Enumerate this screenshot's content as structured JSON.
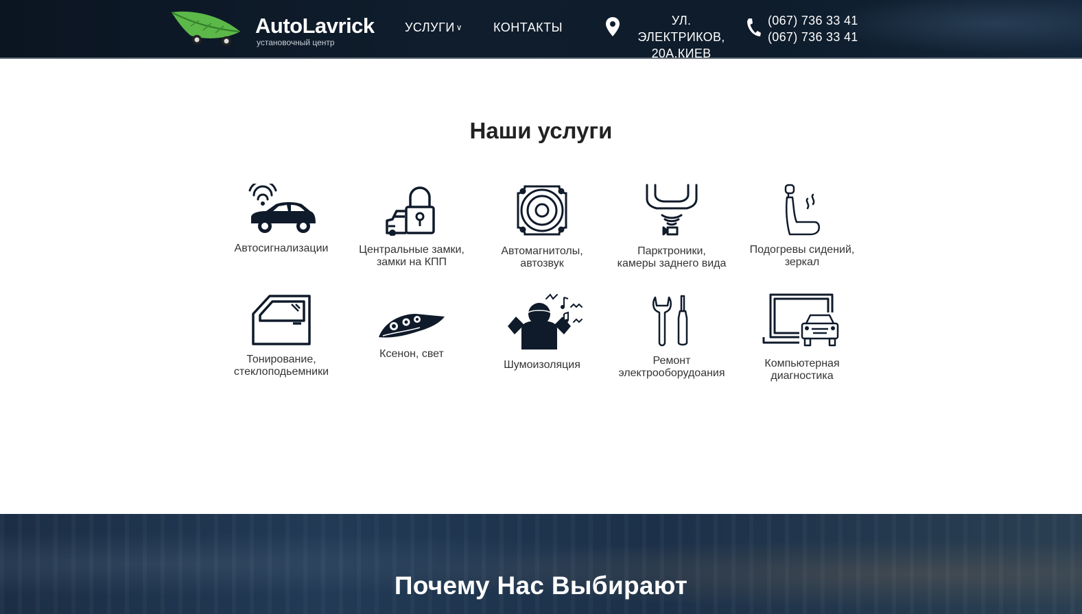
{
  "header": {
    "logo_title": "AutoLavrick",
    "logo_subtitle": "установочный центр",
    "nav": {
      "services_label": "УСЛУГИ",
      "contacts_label": "КОНТАКТЫ"
    },
    "address": {
      "line1": "УЛ. ЭЛЕКТРИКОВ,",
      "line2": "20А,КИЕВ"
    },
    "phones": [
      "(067) 736 33 41",
      "(067) 736 33 41"
    ]
  },
  "services": {
    "title": "Наши услуги",
    "items": [
      {
        "line1": "Автосигнализации",
        "line2": "",
        "icon": "car-alarm-icon"
      },
      {
        "line1": "Центральные замки,",
        "line2": "замки на КПП",
        "icon": "car-lock-icon"
      },
      {
        "line1": "Автомагнитолы,",
        "line2": "автозвук",
        "icon": "speaker-icon"
      },
      {
        "line1": "Парктроники,",
        "line2": "камеры заднего вида",
        "icon": "parking-sensor-icon"
      },
      {
        "line1": "Подогревы сидений,",
        "line2": "зеркал",
        "icon": "heated-seat-icon"
      },
      {
        "line1": "Тонирование,",
        "line2": "стеклоподьемники",
        "icon": "car-door-window-icon"
      },
      {
        "line1": "Ксенон, свет",
        "line2": "",
        "icon": "headlight-icon"
      },
      {
        "line1": "Шумоизоляция",
        "line2": "",
        "icon": "noise-isolation-icon"
      },
      {
        "line1": "Ремонт",
        "line2": "электрооборудоания",
        "icon": "wrench-screwdriver-icon"
      },
      {
        "line1": "Компьютерная",
        "line2": "диагностика",
        "icon": "computer-diagnostics-icon"
      }
    ]
  },
  "banner": {
    "title": "Почему Нас Выбирают"
  },
  "colors": {
    "header_bg": "#0e1c2b",
    "icon": "#0f1a2a",
    "logo_green": "#5cb848"
  }
}
